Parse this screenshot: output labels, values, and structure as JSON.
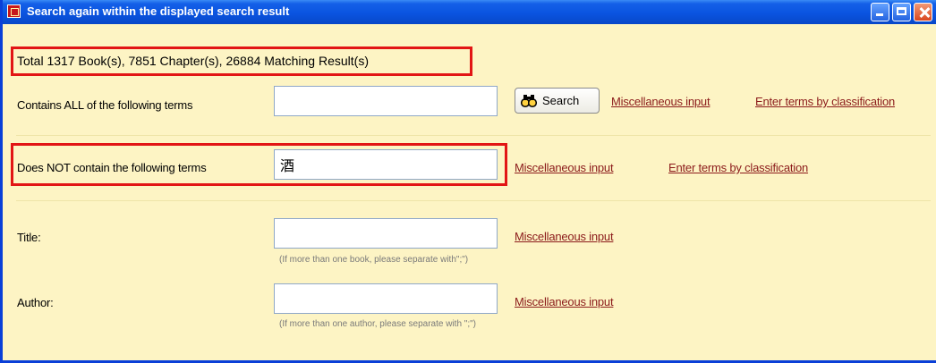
{
  "window": {
    "title": "Search again within the displayed search result"
  },
  "summary": {
    "text": "Total 1317 Book(s), 7851 Chapter(s), 26884 Matching Result(s)"
  },
  "contains_all": {
    "label": "Contains ALL of the following terms",
    "value": "",
    "search_button": "Search",
    "misc_link": "Miscellaneous input",
    "classify_link": "Enter terms by classification"
  },
  "not_contain": {
    "label": "Does NOT contain the following terms",
    "value": "酒",
    "misc_link": "Miscellaneous input",
    "classify_link": "Enter terms by classification"
  },
  "title_field": {
    "label": "Title:",
    "value": "",
    "misc_link": "Miscellaneous input",
    "hint": "(If more than one book, please separate with\";\")"
  },
  "author_field": {
    "label": "Author:",
    "value": "",
    "misc_link": "Miscellaneous input",
    "hint": "(If more than one author, please separate with \";\")"
  },
  "colors": {
    "background": "#fdf4c4",
    "highlight": "#e21515",
    "link": "#8b1a1a",
    "titlebar": "#0a54e0"
  },
  "icons": {
    "app": "app-icon",
    "search": "binoculars-icon"
  }
}
